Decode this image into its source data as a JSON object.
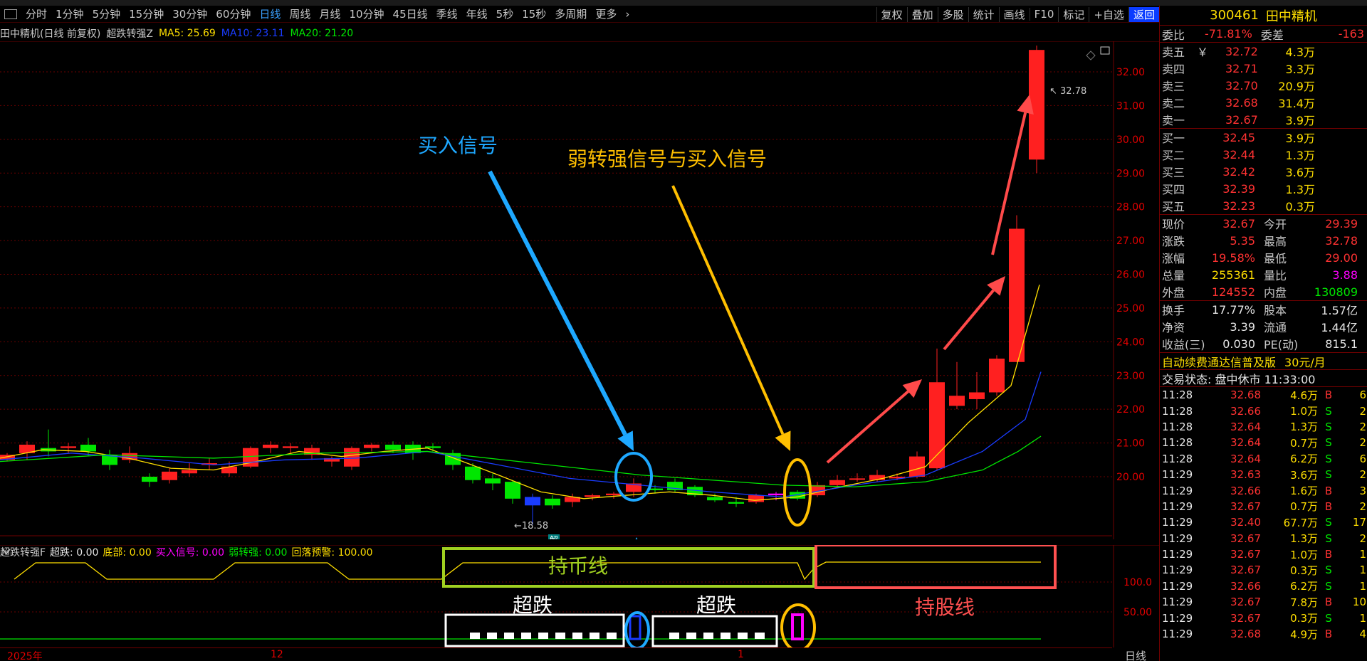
{
  "periods": [
    "分时",
    "1分钟",
    "5分钟",
    "15分钟",
    "30分钟",
    "60分钟",
    "日线",
    "周线",
    "月线",
    "10分钟",
    "45日线",
    "季线",
    "年线",
    "5秒",
    "15秒",
    "多周期",
    "更多"
  ],
  "active_period": "日线",
  "right_buttons": [
    "复权",
    "叠加",
    "多股",
    "统计",
    "画线",
    "F10",
    "标记",
    "+自选",
    "返回"
  ],
  "chart": {
    "stock_label": "田中精机(日线 前复权)",
    "indicator_name": "超跌转强Z",
    "ma5": "MA5: 25.69",
    "ma10": "MA10: 23.11",
    "ma20": "MA20: 21.20",
    "high_label": "32.78",
    "low_label": "18.58",
    "jie_badge": "解",
    "price_ticks": [
      "32.00",
      "31.00",
      "30.00",
      "29.00",
      "28.00",
      "27.00",
      "26.00",
      "25.00",
      "24.00",
      "23.00",
      "22.00",
      "21.00",
      "20.00"
    ],
    "ind_ticks": [
      "100.0",
      "50.00"
    ],
    "x_labels": [
      "2025年",
      "12",
      "1"
    ],
    "period_label": "日线"
  },
  "indicator": {
    "name": "超跌转强F",
    "items": [
      {
        "label": "超跌: 0.00",
        "color": "#e6e6e6"
      },
      {
        "label": "底部: 0.00",
        "color": "#ffdf00"
      },
      {
        "label": "买入信号: 0.00",
        "color": "#ff00ff"
      },
      {
        "label": "弱转强: 0.00",
        "color": "#00e600"
      },
      {
        "label": "回落预警: 100.00",
        "color": "#ffdf00"
      }
    ]
  },
  "annotations": {
    "buy_signal": "买入信号",
    "weak_to_strong": "弱转强信号与买入信号",
    "hold_coin": "持币线",
    "oversold_1": "超跌",
    "oversold_2": "超跌",
    "hold_stock": "持股线"
  },
  "panel": {
    "code": "300461",
    "name": "田中精机",
    "weibi_label": "委比",
    "weibi_value": "-71.81%",
    "weicha_label": "委差",
    "weicha_value": "-163",
    "asks": [
      {
        "label": "卖五",
        "price": "32.72",
        "vol": "4.3万",
        "mark": "￥"
      },
      {
        "label": "卖四",
        "price": "32.71",
        "vol": "3.3万",
        "mark": ""
      },
      {
        "label": "卖三",
        "price": "32.70",
        "vol": "20.9万",
        "mark": ""
      },
      {
        "label": "卖二",
        "price": "32.68",
        "vol": "31.4万",
        "mark": ""
      },
      {
        "label": "卖一",
        "price": "32.67",
        "vol": "3.9万",
        "mark": ""
      }
    ],
    "bids": [
      {
        "label": "买一",
        "price": "32.45",
        "vol": "3.9万"
      },
      {
        "label": "买二",
        "price": "32.44",
        "vol": "1.3万"
      },
      {
        "label": "买三",
        "price": "32.42",
        "vol": "3.6万"
      },
      {
        "label": "买四",
        "price": "32.39",
        "vol": "1.3万"
      },
      {
        "label": "买五",
        "price": "32.23",
        "vol": "0.3万"
      }
    ],
    "stats": [
      {
        "l1": "现价",
        "v1": "32.67",
        "c1": "red",
        "l2": "今开",
        "v2": "29.39",
        "c2": "red"
      },
      {
        "l1": "涨跌",
        "v1": "5.35",
        "c1": "red",
        "l2": "最高",
        "v2": "32.78",
        "c2": "red"
      },
      {
        "l1": "涨幅",
        "v1": "19.58%",
        "c1": "red",
        "l2": "最低",
        "v2": "29.00",
        "c2": "red"
      },
      {
        "l1": "总量",
        "v1": "255361",
        "c1": "yellow",
        "l2": "量比",
        "v2": "3.88",
        "c2": "magenta"
      },
      {
        "l1": "外盘",
        "v1": "124552",
        "c1": "red",
        "l2": "内盘",
        "v2": "130809",
        "c2": "green"
      }
    ],
    "stats2": [
      {
        "l1": "换手",
        "v1": "17.77%",
        "l2": "股本",
        "v2": "1.57亿"
      },
      {
        "l1": "净资",
        "v1": "3.39",
        "l2": "流通",
        "v2": "1.44亿"
      },
      {
        "l1": "收益(三)",
        "v1": "0.030",
        "l2": "PE(动)",
        "v2": "815.1"
      }
    ],
    "promo": "自动续费通达信普及版",
    "promo_price": "30元/月",
    "trade_status": "交易状态: 盘中休市 11:33:00",
    "ticks": [
      {
        "t": "11:28",
        "p": "32.68",
        "v": "4.6万",
        "bs": "B",
        "n": "6"
      },
      {
        "t": "11:28",
        "p": "32.66",
        "v": "1.0万",
        "bs": "S",
        "n": "2"
      },
      {
        "t": "11:28",
        "p": "32.64",
        "v": "1.3万",
        "bs": "S",
        "n": "2"
      },
      {
        "t": "11:28",
        "p": "32.64",
        "v": "0.7万",
        "bs": "S",
        "n": "2"
      },
      {
        "t": "11:28",
        "p": "32.64",
        "v": "6.2万",
        "bs": "S",
        "n": "6"
      },
      {
        "t": "11:29",
        "p": "32.63",
        "v": "3.6万",
        "bs": "S",
        "n": "2"
      },
      {
        "t": "11:29",
        "p": "32.66",
        "v": "1.6万",
        "bs": "B",
        "n": "3"
      },
      {
        "t": "11:29",
        "p": "32.67",
        "v": "0.7万",
        "bs": "B",
        "n": "2"
      },
      {
        "t": "11:29",
        "p": "32.40",
        "v": "67.7万",
        "bs": "S",
        "n": "17"
      },
      {
        "t": "11:29",
        "p": "32.67",
        "v": "1.3万",
        "bs": "S",
        "n": "2"
      },
      {
        "t": "11:29",
        "p": "32.67",
        "v": "1.0万",
        "bs": "B",
        "n": "1"
      },
      {
        "t": "11:29",
        "p": "32.67",
        "v": "0.3万",
        "bs": "S",
        "n": "1"
      },
      {
        "t": "11:29",
        "p": "32.66",
        "v": "6.2万",
        "bs": "S",
        "n": "1"
      },
      {
        "t": "11:29",
        "p": "32.67",
        "v": "7.8万",
        "bs": "B",
        "n": "10"
      },
      {
        "t": "11:29",
        "p": "32.67",
        "v": "0.3万",
        "bs": "S",
        "n": "1"
      },
      {
        "t": "11:29",
        "p": "32.68",
        "v": "4.9万",
        "bs": "B",
        "n": "4"
      }
    ]
  }
}
